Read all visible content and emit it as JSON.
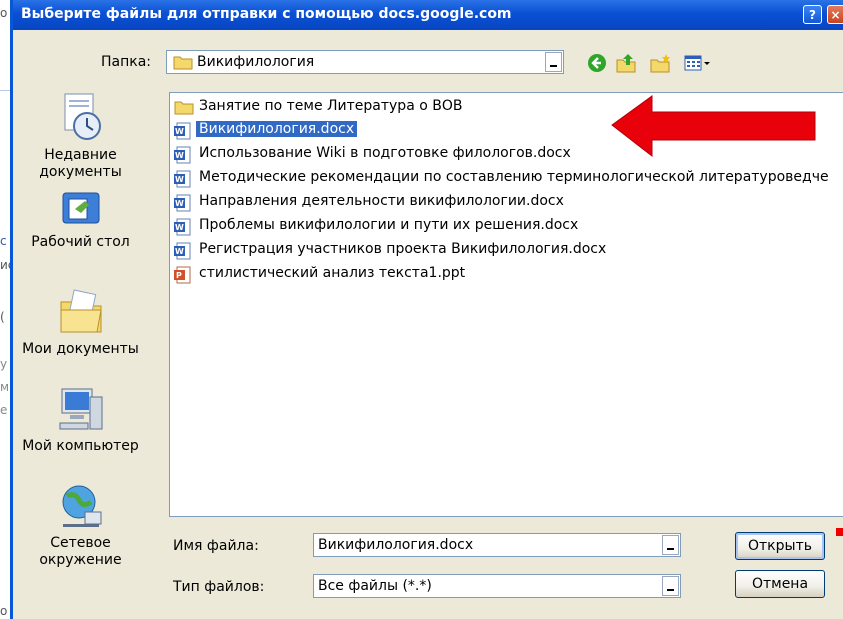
{
  "dialog": {
    "title": "Выберите файлы для отправки с помощью docs.google.com",
    "help_glyph": "?",
    "close_glyph": "×"
  },
  "folder": {
    "label": "Папка:",
    "value": "Викифилология"
  },
  "toolbar": {
    "icons": [
      "back-icon",
      "up-folder-icon",
      "new-folder-icon",
      "view-menu-icon"
    ]
  },
  "places": [
    {
      "label": "Недавние документы",
      "icon": "recent-documents-icon"
    },
    {
      "label": "Рабочий стол",
      "icon": "desktop-icon"
    },
    {
      "label": "Мои документы",
      "icon": "my-documents-icon"
    },
    {
      "label": "Мой компьютер",
      "icon": "my-computer-icon"
    },
    {
      "label": "Сетевое окружение",
      "icon": "network-icon"
    }
  ],
  "files": [
    {
      "name": "Занятие по теме Литература о ВОВ",
      "type": "folder"
    },
    {
      "name": "Викифилология.docx",
      "type": "docx",
      "selected": true
    },
    {
      "name": "Использование Wiki в подготовке филологов.docx",
      "type": "docx"
    },
    {
      "name": "Методические рекомендации по составлению терминологической литературоведче",
      "type": "docx"
    },
    {
      "name": "Направления деятельности викифилологии.docx",
      "type": "docx"
    },
    {
      "name": "Проблемы викифилологии и пути их решения.docx",
      "type": "docx"
    },
    {
      "name": "Регистрация участников проекта Викифилология.docx",
      "type": "docx"
    },
    {
      "name": "стилистический анализ текста1.ppt",
      "type": "ppt"
    }
  ],
  "filename": {
    "label": "Имя файла:",
    "value": "Викифилология.docx"
  },
  "filetype": {
    "label": "Тип файлов:",
    "value": "Все файлы (*.*)"
  },
  "buttons": {
    "open": "Открыть",
    "cancel": "Отмена"
  },
  "background_fragments": [
    "о",
    "с",
    "ие",
    "(",
    "у",
    "м",
    "е",
    "о"
  ],
  "colors": {
    "title_bar": "#0a50d4",
    "selection": "#316ac5",
    "arrow": "#e8000b",
    "dialog_bg": "#ece9d8"
  }
}
